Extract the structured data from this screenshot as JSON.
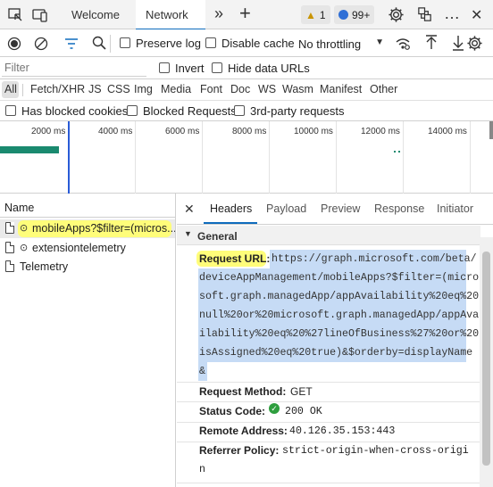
{
  "tabbar": {
    "tabs": [
      {
        "label": "Welcome",
        "active": false
      },
      {
        "label": "Network",
        "active": true
      }
    ],
    "more_tabs_glyph": "»",
    "new_tab_glyph": "+",
    "warnings_count": "1",
    "messages_count": "99+",
    "close_glyph": "✕",
    "more_glyph": "…"
  },
  "toolbar": {
    "preserve_log_label": "Preserve log",
    "disable_cache_label": "Disable cache",
    "throttling_value": "No throttling"
  },
  "filter": {
    "placeholder": "Filter",
    "invert_label": "Invert",
    "hide_data_urls_label": "Hide data URLs"
  },
  "types": [
    "All",
    "Fetch/XHR",
    "JS",
    "CSS",
    "Img",
    "Media",
    "Font",
    "Doc",
    "WS",
    "Wasm",
    "Manifest",
    "Other"
  ],
  "blocked": {
    "blocked_cookies_label": "Has blocked cookies",
    "blocked_requests_label": "Blocked Requests",
    "third_party_label": "3rd-party requests"
  },
  "timeline": {
    "ticks": [
      "2000 ms",
      "4000 ms",
      "6000 ms",
      "8000 ms",
      "10000 ms",
      "12000 ms",
      "14000 ms"
    ]
  },
  "request_list": {
    "header": "Name",
    "items": [
      {
        "name": "mobileApps?$filter=(micros...",
        "selected": true,
        "icon": "fetch-icon"
      },
      {
        "name": "extensiontelemetry",
        "selected": false,
        "icon": "fetch-icon"
      },
      {
        "name": "Telemetry",
        "selected": false,
        "icon": "document-icon"
      }
    ]
  },
  "detail": {
    "tabs": [
      "Headers",
      "Payload",
      "Preview",
      "Response",
      "Initiator"
    ],
    "active_tab": "Headers",
    "section_title": "General",
    "request_url_label": "Request URL:",
    "request_url_lines": [
      "https://graph.microsoft.com/beta/",
      "deviceAppManagement/mobileApps?$filter=(micro",
      "soft.graph.managedApp/appAvailability%20eq%20",
      "null%20or%20microsoft.graph.managedApp/appAva",
      "ilability%20eq%20%27lineOfBusiness%27%20or%20",
      "isAssigned%20eq%20true)&$orderby=displayName",
      "&"
    ],
    "request_method_label": "Request Method:",
    "request_method_value": "GET",
    "status_code_label": "Status Code:",
    "status_code_value": "200 OK",
    "remote_address_label": "Remote Address:",
    "remote_address_value": "40.126.35.153:443",
    "referrer_policy_label": "Referrer Policy:",
    "referrer_policy_lines": [
      "strict-origin-when-cross-origi",
      "n"
    ]
  },
  "colors": {
    "accent": "#0f6cbd",
    "highlight": "#fffd7a",
    "selection": "#c6dbf5",
    "status_ok": "#2e9e3e"
  }
}
